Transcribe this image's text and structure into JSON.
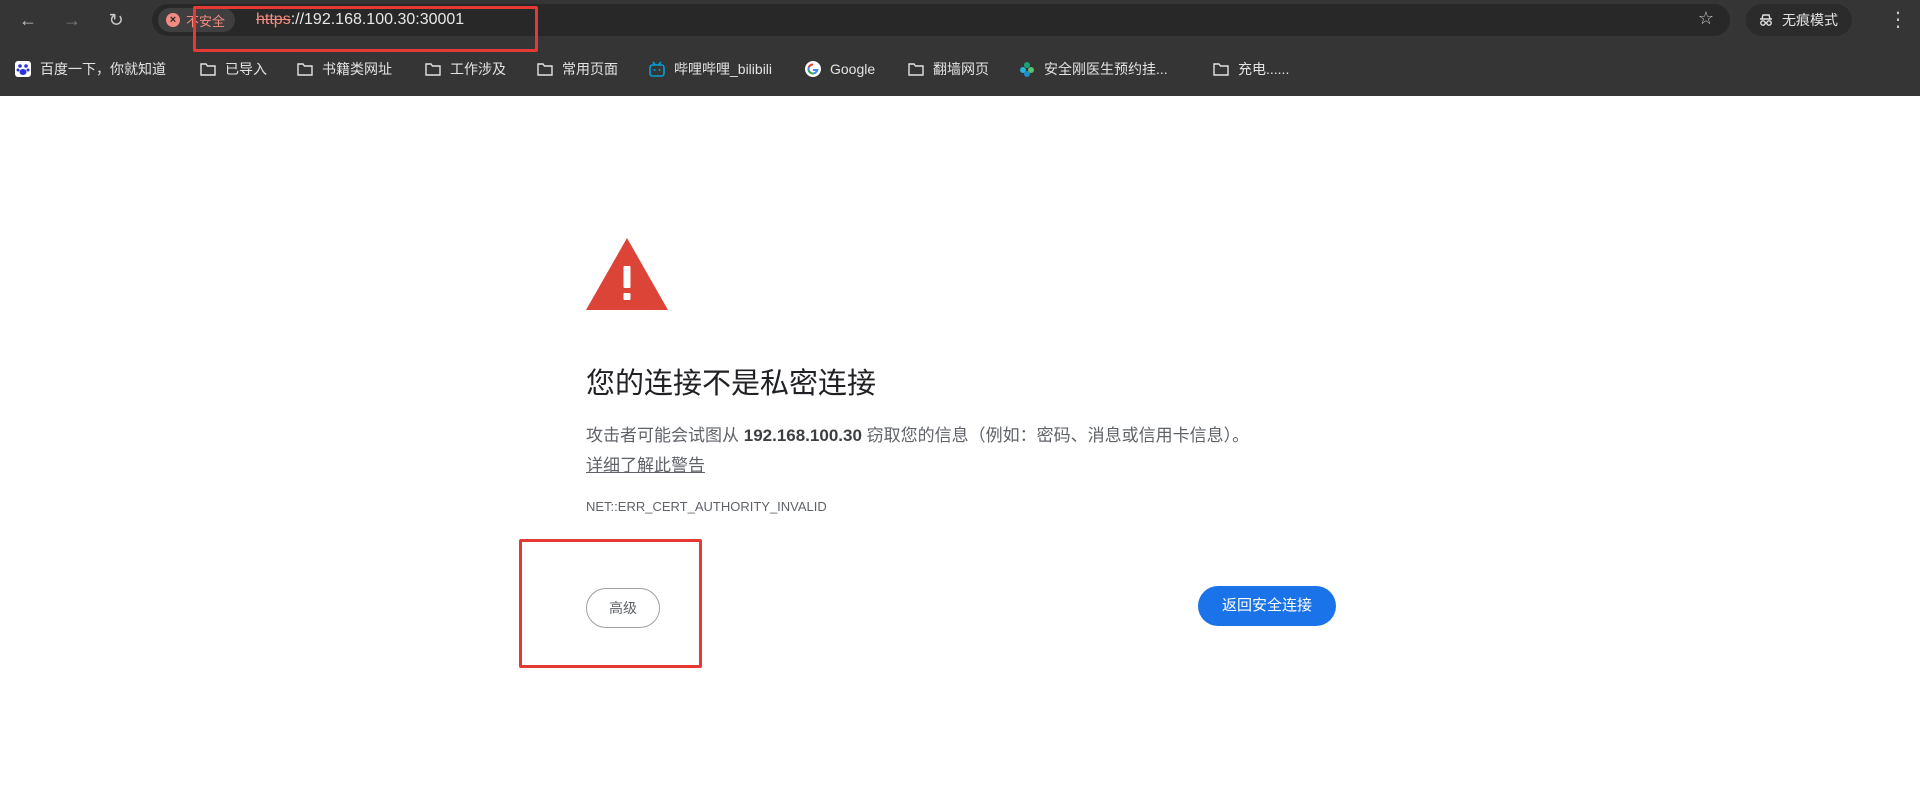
{
  "toolbar": {
    "back": "←",
    "forward": "→",
    "reload": "↻",
    "security_label": "不安全",
    "url_scheme": "https",
    "url_rest": "://192.168.100.30:30001",
    "bookmark_star": "☆",
    "incognito_label": "无痕模式",
    "menu": "⋮"
  },
  "bookmarks": [
    {
      "label": "百度一下，你就知道",
      "icon": "baidu-icon"
    },
    {
      "label": "已导入",
      "icon": "folder-icon"
    },
    {
      "label": "书籍类网址",
      "icon": "folder-icon"
    },
    {
      "label": "工作涉及",
      "icon": "folder-icon"
    },
    {
      "label": "常用页面",
      "icon": "folder-icon"
    },
    {
      "label": "哔哩哔哩_bilibili",
      "icon": "bilibili-icon"
    },
    {
      "label": "Google",
      "icon": "google-icon"
    },
    {
      "label": "翻墙网页",
      "icon": "folder-icon"
    },
    {
      "label": "安全刚医生预约挂...",
      "icon": "medical-icon"
    },
    {
      "label": "充电......",
      "icon": "folder-icon"
    }
  ],
  "content": {
    "heading": "您的连接不是私密连接",
    "desc_prefix": "攻击者可能会试图从 ",
    "desc_host": "192.168.100.30",
    "desc_suffix": " 窃取您的信息（例如：密码、消息或信用卡信息）。",
    "learn_more": "详细了解此警告",
    "error_code": "NET::ERR_CERT_AUTHORITY_INVALID",
    "advanced_button": "高级",
    "back_button": "返回安全连接"
  },
  "colors": {
    "chrome_dark": "#353535",
    "warning_red": "#db4437",
    "primary_blue": "#1a73e8",
    "annotation_red": "#e53935"
  }
}
